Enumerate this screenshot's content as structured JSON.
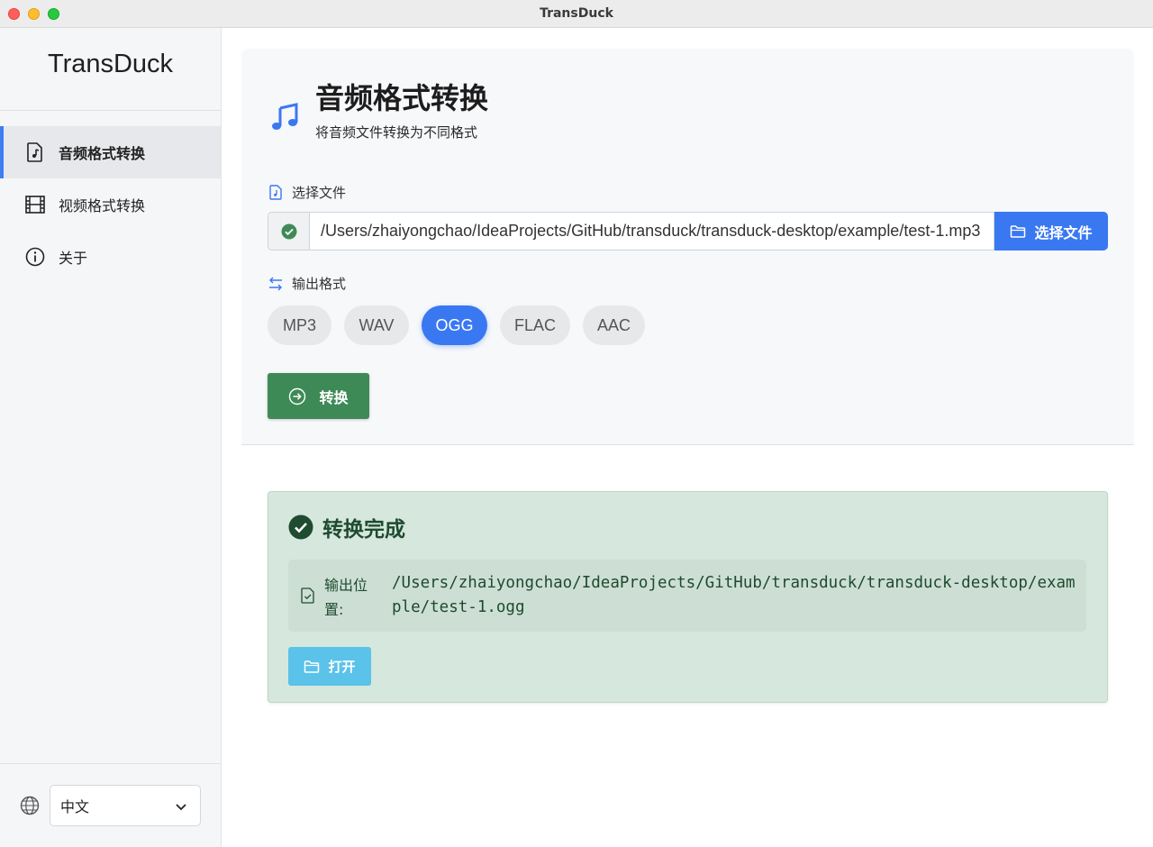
{
  "window": {
    "title": "TransDuck"
  },
  "sidebar": {
    "brand": "TransDuck",
    "items": [
      {
        "label": "音频格式转换",
        "icon": "audio-file-icon",
        "active": true
      },
      {
        "label": "视频格式转换",
        "icon": "film-icon",
        "active": false
      },
      {
        "label": "关于",
        "icon": "info-icon",
        "active": false
      }
    ],
    "language": {
      "icon": "globe-icon",
      "selected": "中文"
    }
  },
  "main": {
    "header": {
      "icon": "music-note-icon",
      "title": "音频格式转换",
      "subtitle": "将音频文件转换为不同格式"
    },
    "file": {
      "label": "选择文件",
      "status_icon": "check-circle-icon",
      "path": "/Users/zhaiyongchao/IdeaProjects/GitHub/transduck/transduck-desktop/example/test-1.mp3",
      "button_label": "选择文件"
    },
    "format": {
      "label": "输出格式",
      "options": [
        "MP3",
        "WAV",
        "OGG",
        "FLAC",
        "AAC"
      ],
      "selected": "OGG"
    },
    "convert_label": "转换"
  },
  "result": {
    "title": "转换完成",
    "output_label": "输出位置:",
    "output_path": "/Users/zhaiyongchao/IdeaProjects/GitHub/transduck/transduck-desktop/example/test-1.ogg",
    "open_label": "打开"
  },
  "colors": {
    "primary": "#3a78f2",
    "success": "#3e8a57",
    "success_bg": "#d6e7dd",
    "info": "#5bc2ea"
  }
}
